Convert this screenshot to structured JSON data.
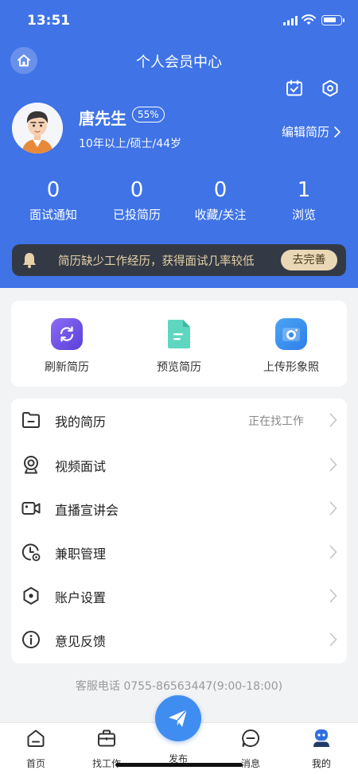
{
  "status_bar": {
    "time": "13:51",
    "battery_level": 0.8
  },
  "header": {
    "title": "个人会员中心",
    "user": {
      "name": "唐先生",
      "completion": "55%",
      "meta": "10年以上/硕士/44岁"
    },
    "edit_resume": "编辑简历",
    "stats": [
      {
        "value": "0",
        "label": "面试通知"
      },
      {
        "value": "0",
        "label": "已投简历"
      },
      {
        "value": "0",
        "label": "收藏/关注"
      },
      {
        "value": "1",
        "label": "浏览"
      }
    ],
    "notice": {
      "text": "简历缺少工作经历，获得面试几率较低",
      "button": "去完善"
    }
  },
  "quick_actions": [
    {
      "label": "刷新简历",
      "icon": "refresh-icon"
    },
    {
      "label": "预览简历",
      "icon": "document-icon"
    },
    {
      "label": "上传形象照",
      "icon": "camera-icon"
    }
  ],
  "menu": [
    {
      "label": "我的简历",
      "value": "正在找工作",
      "icon": "folder-icon"
    },
    {
      "label": "视频面试",
      "value": "",
      "icon": "webcam-icon"
    },
    {
      "label": "直播宣讲会",
      "value": "",
      "icon": "video-camera-icon"
    },
    {
      "label": "兼职管理",
      "value": "",
      "icon": "clock-icon"
    },
    {
      "label": "账户设置",
      "value": "",
      "icon": "hexagon-settings-icon"
    },
    {
      "label": "意见反馈",
      "value": "",
      "icon": "info-icon"
    }
  ],
  "hotline": "客服电话 0755-86563447(9:00-18:00)",
  "tabs": [
    {
      "label": "首页",
      "icon": "home-icon"
    },
    {
      "label": "找工作",
      "icon": "briefcase-icon"
    },
    {
      "label": "发布",
      "icon": "paper-plane-icon"
    },
    {
      "label": "消息",
      "icon": "message-icon"
    },
    {
      "label": "我的",
      "icon": "user-icon"
    }
  ],
  "colors": {
    "primary": "#3f73e6",
    "notice_bg": "#333a45",
    "notice_text": "#e6d1a8",
    "notice_button": "#ead7b5",
    "publish": "#3f8df0"
  }
}
